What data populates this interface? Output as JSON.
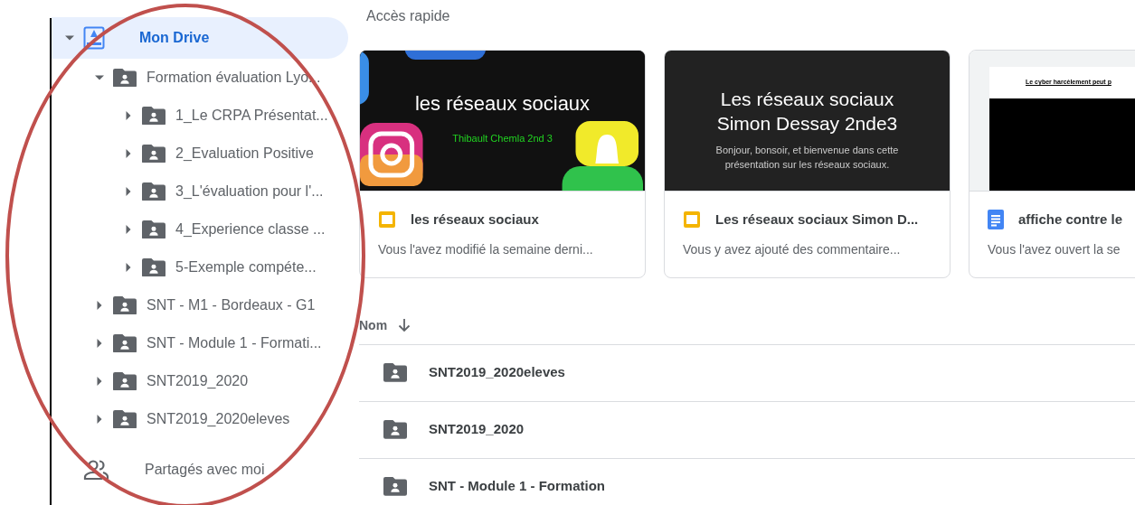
{
  "sidebar": {
    "items": [
      {
        "label": "Mon Drive",
        "kind": "drive",
        "selected": true,
        "expanded": true,
        "children": [
          {
            "label": "Formation évaluation Lyo...",
            "kind": "folder",
            "selected": false,
            "expanded": true,
            "children": [
              {
                "label": "1_Le CRPA Présentat...",
                "kind": "folder",
                "selected": false,
                "expanded": false
              },
              {
                "label": "2_Evaluation Positive",
                "kind": "folder",
                "selected": false,
                "expanded": false
              },
              {
                "label": "3_L'évaluation pour l'...",
                "kind": "folder",
                "selected": false,
                "expanded": false
              },
              {
                "label": "4_Experience classe ...",
                "kind": "folder",
                "selected": false,
                "expanded": false
              },
              {
                "label": "5-Exemple compéte...",
                "kind": "folder",
                "selected": false,
                "expanded": false
              }
            ]
          },
          {
            "label": "SNT - M1 - Bordeaux - G1",
            "kind": "folder",
            "selected": false,
            "expanded": false
          },
          {
            "label": "SNT - Module 1 - Formati...",
            "kind": "folder",
            "selected": false,
            "expanded": false
          },
          {
            "label": "SNT2019_2020",
            "kind": "folder",
            "selected": false,
            "expanded": false
          },
          {
            "label": "SNT2019_2020eleves",
            "kind": "folder",
            "selected": false,
            "expanded": false
          }
        ]
      },
      {
        "label": "Partagés avec moi",
        "kind": "shared",
        "selected": false
      }
    ]
  },
  "quick_access": {
    "title": "Accès rapide",
    "cards": [
      {
        "kind": "slides",
        "thumbnail": {
          "title": "les réseaux sociaux",
          "subtitle": "Thibault Chemla 2nd 3"
        },
        "name": "les réseaux sociaux",
        "activity": "Vous l'avez modifié la semaine derni..."
      },
      {
        "kind": "slides",
        "thumbnail": {
          "kind": "slide",
          "title": "Les réseaux sociaux Simon Dessay 2nde3",
          "subtitle": "Bonjour, bonsoir, et bienvenue dans cette présentation sur les réseaux sociaux."
        },
        "name": "Les réseaux sociaux Simon D...",
        "activity": "Vous y avez ajouté des commentaire..."
      },
      {
        "kind": "docs",
        "thumbnail": {
          "kind": "document",
          "title": "Le cyber harcèlement peut p"
        },
        "name": "affiche contre le",
        "activity": "Vous l'avez ouvert la se"
      }
    ]
  },
  "file_list": {
    "sort_column": "Nom",
    "rows": [
      {
        "name": "SNT2019_2020eleves"
      },
      {
        "name": "SNT2019_2020"
      },
      {
        "name": "SNT - Module 1 - Formation"
      }
    ]
  },
  "annotation": {
    "kind": "ellipse",
    "color": "#c0504d"
  }
}
